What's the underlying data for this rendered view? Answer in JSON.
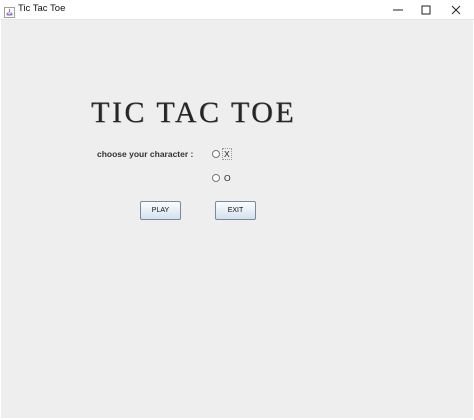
{
  "window": {
    "title": "Tic Tac Toe",
    "icons": [
      "java-app-icon",
      "minimize-icon",
      "maximize-icon",
      "close-icon"
    ]
  },
  "main": {
    "heading": "TIC TAC TOE",
    "prompt": "choose your character :",
    "options": [
      {
        "label": "X",
        "selected": false
      },
      {
        "label": "O",
        "selected": false
      }
    ],
    "buttons": {
      "play": "PLAY",
      "exit": "EXIT"
    }
  },
  "colors": {
    "window_background": "#eeeeee",
    "title_bar": "#ffffff",
    "button_gradient_bottom": "#d3e1ee"
  }
}
